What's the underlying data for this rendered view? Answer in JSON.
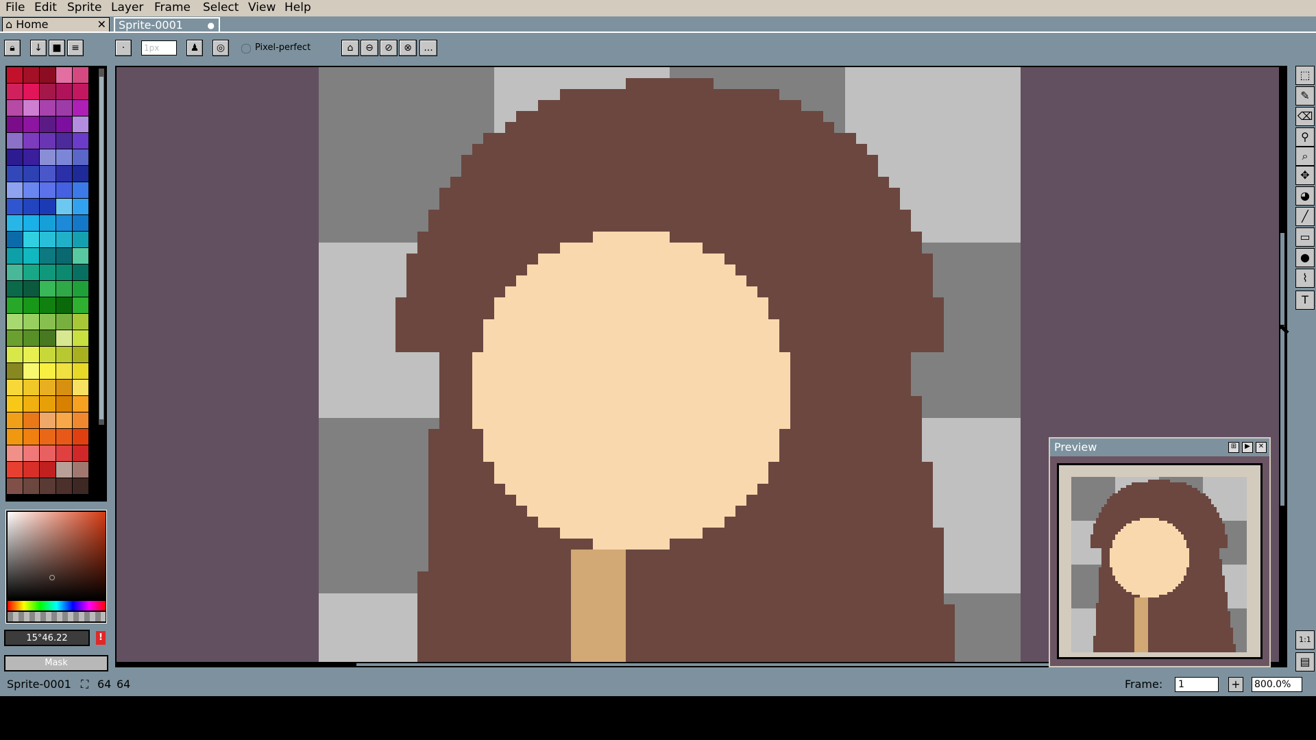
{
  "menubar": {
    "items": [
      "File",
      "Edit",
      "Sprite",
      "Layer",
      "Frame",
      "Select",
      "View",
      "Help"
    ]
  },
  "tabs": {
    "home_label": "Home",
    "sprite_label": "Sprite-0001"
  },
  "toolbar": {
    "brush_size_placeholder": "1px",
    "pixel_perfect_label": "Pixel-perfect",
    "more_label": "..."
  },
  "colorbar": {
    "color_value": "15°46.22",
    "warning": "!",
    "mask_label": "Mask"
  },
  "preview": {
    "title": "Preview"
  },
  "statusbar": {
    "sprite_name": "Sprite-0001",
    "size_w": "64",
    "size_h": "64",
    "frame_label": "Frame:",
    "frame_value": "1",
    "zoom_value": "800.0%"
  },
  "colors": {
    "hair": "#6b4740",
    "skin": "#f9d8ae",
    "neck": "#d2a874",
    "checker_dark": "#808080",
    "checker_light": "#c0c0c0",
    "workspace_bg": "#625061",
    "ui_accent": "#7d929e"
  },
  "palette": [
    "#c4112b",
    "#a41026",
    "#8c0d22",
    "#e36fa2",
    "#d44a80",
    "#d0215c",
    "#e2145a",
    "#a31848",
    "#b0135a",
    "#c3185f",
    "#b74aa4",
    "#cf7fd1",
    "#a842ad",
    "#9d3ba8",
    "#ae20b5",
    "#7c0d8a",
    "#8e14a2",
    "#5c1a86",
    "#7c0fa0",
    "#b38ee0",
    "#8b71c8",
    "#7d3cc0",
    "#6a35b5",
    "#4c2a9c",
    "#6a3cc9",
    "#2d1b92",
    "#3a1e9c",
    "#8a8fd5",
    "#7c86d8",
    "#5a66c8",
    "#3348b8",
    "#2e41b2",
    "#4a57c8",
    "#2b30a8",
    "#1e2a98",
    "#8fa2f0",
    "#6a86f0",
    "#5b72ea",
    "#4560e0",
    "#3c7ae8",
    "#3055d0",
    "#2244c0",
    "#1b3ab5",
    "#6cc8f0",
    "#32a2f0",
    "#28b6e8",
    "#1ab0e8",
    "#15a0d8",
    "#1c8ad8",
    "#1478c8",
    "#0b6aa8",
    "#30d0e0",
    "#28c0d8",
    "#20b0c8",
    "#14a0b0",
    "#0ea0a8",
    "#12b8c0",
    "#0c7a80",
    "#0a6870",
    "#58c8a0",
    "#48b898",
    "#18a888",
    "#10987c",
    "#0c8a70",
    "#087060",
    "#0a6a4a",
    "#0b5a3e",
    "#38b858",
    "#30a848",
    "#20a038",
    "#28a828",
    "#189818",
    "#108010",
    "#0a6a0a",
    "#30b030",
    "#a8d870",
    "#98d060",
    "#88c050",
    "#78b040",
    "#a8c838",
    "#6aa030",
    "#589028",
    "#487820",
    "#d8e890",
    "#c8e040",
    "#d8e848",
    "#e8f050",
    "#c8d838",
    "#b8c830",
    "#a8b020",
    "#888820",
    "#f8f870",
    "#f8f040",
    "#f0e040",
    "#e8d828",
    "#f8d838",
    "#f0c828",
    "#e8b020",
    "#d89010",
    "#f8e060",
    "#f8c818",
    "#f0b010",
    "#e8a008",
    "#d88000",
    "#f8a020",
    "#f0a018",
    "#e87818",
    "#f0a868",
    "#f8a848",
    "#f08830",
    "#f09810",
    "#f08010",
    "#e86818",
    "#e85818",
    "#e04010",
    "#f09088",
    "#f07878",
    "#e86060",
    "#e04040",
    "#d02828",
    "#e84030",
    "#d83028",
    "#c02020",
    "#b8a098",
    "#a07870",
    "#805048",
    "#6b4740",
    "#5a3a34",
    "#4c302c",
    "#3e2824"
  ]
}
